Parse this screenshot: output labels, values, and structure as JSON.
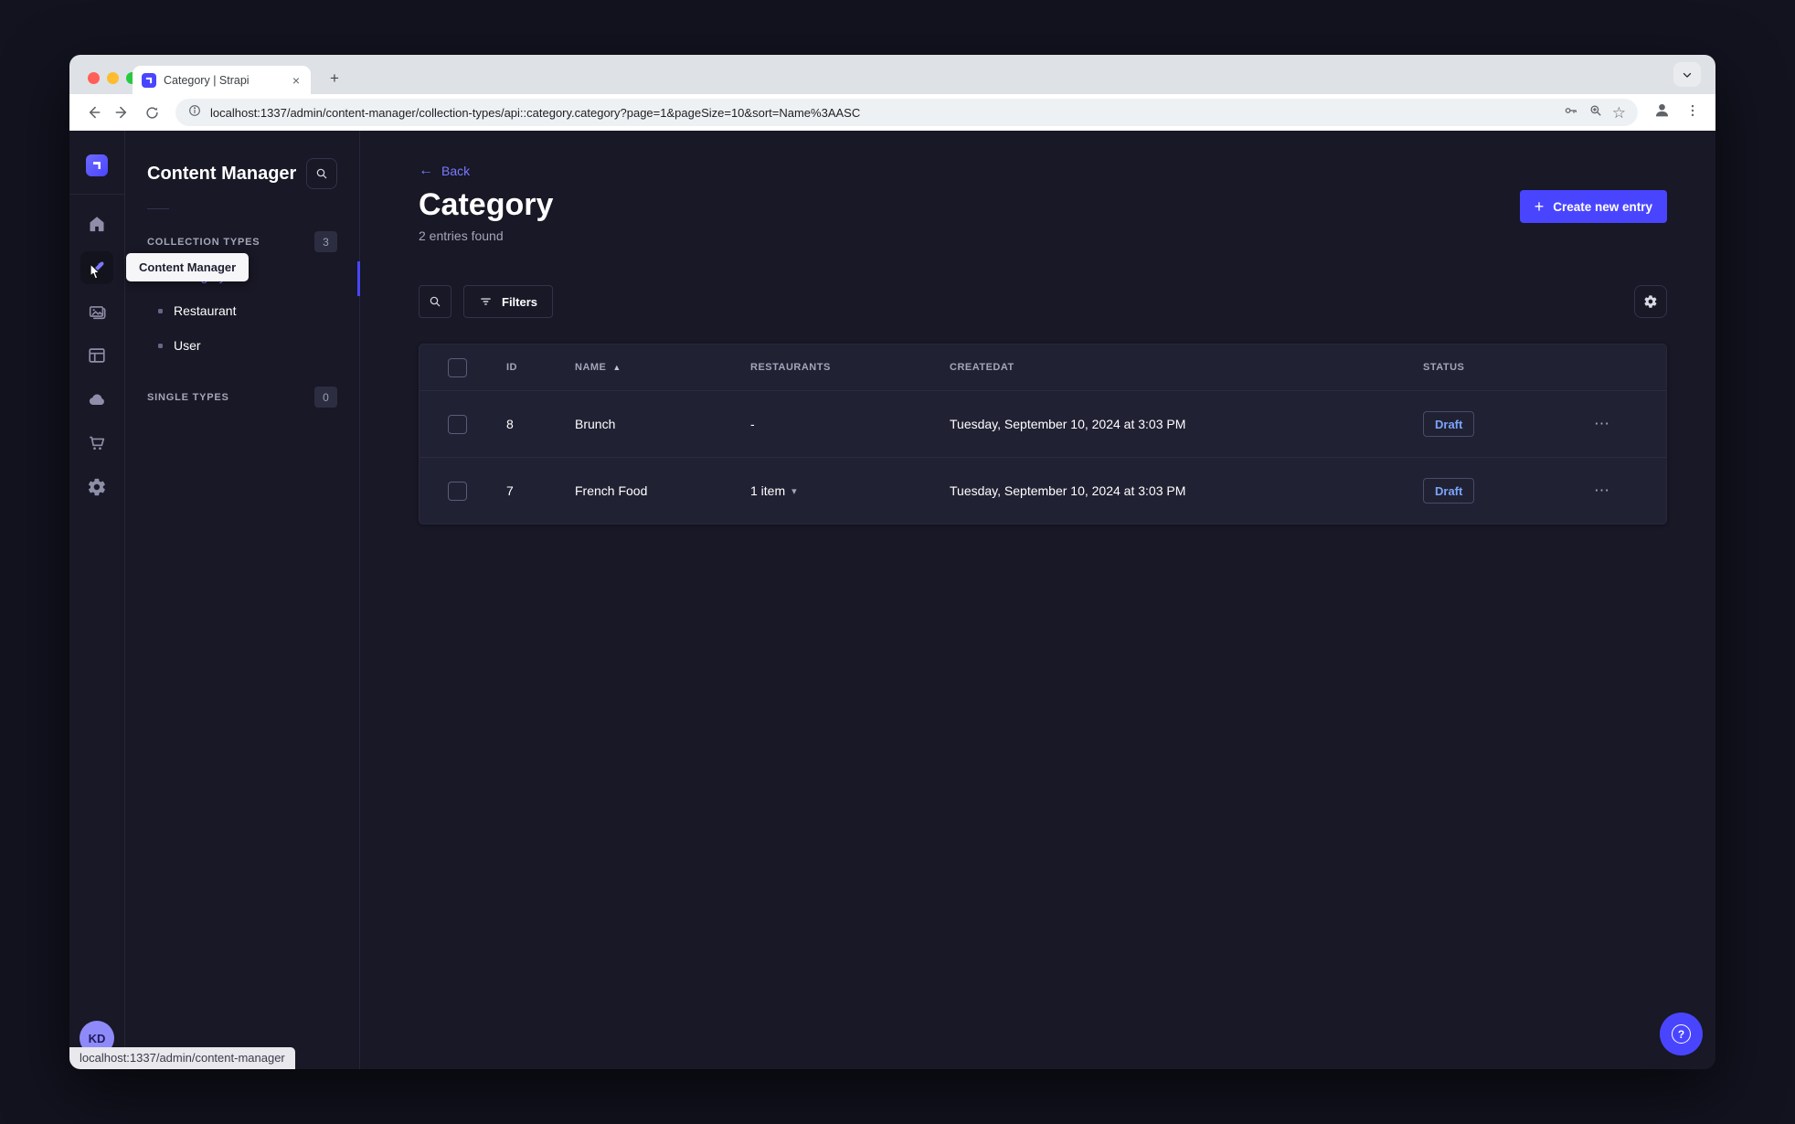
{
  "colors": {
    "primary": "#4945ff",
    "link": "#7b79ff",
    "draft_text": "#7ba4f8",
    "app_bg": "#181826",
    "card_bg": "#212134",
    "traffic_red": "#ff5f57",
    "traffic_yellow": "#febc2e",
    "traffic_green": "#28c840"
  },
  "browser": {
    "tab_title": "Category | Strapi",
    "url": "localhost:1337/admin/content-manager/collection-types/api::category.category?page=1&pageSize=10&sort=Name%3AASC",
    "status_url": "localhost:1337/admin/content-manager"
  },
  "icons": {
    "plus": "+",
    "close": "×",
    "star": "☆",
    "back_arrow": "←",
    "sort_asc": "▲",
    "item_chevron": "▾",
    "ellipsis": "⋯",
    "question": "?"
  },
  "rail": {
    "user_initials": "KD"
  },
  "sidebar": {
    "title": "Content Manager",
    "tooltip": "Content Manager",
    "collection_section": "COLLECTION TYPES",
    "collection_badge": "3",
    "items": [
      {
        "label": "Category"
      },
      {
        "label": "Restaurant"
      },
      {
        "label": "User"
      }
    ],
    "single_section": "SINGLE TYPES",
    "single_badge": "0"
  },
  "main": {
    "back": "Back",
    "title": "Category",
    "subtitle": "2 entries found",
    "create_button": "Create new entry",
    "filters_button": "Filters",
    "table": {
      "headers": {
        "id": "ID",
        "name": "NAME",
        "restaurants": "RESTAURANTS",
        "createdat": "CREATEDAT",
        "status": "STATUS"
      },
      "rows": [
        {
          "id": "8",
          "name": "Brunch",
          "restaurants": "-",
          "created": "Tuesday, September 10, 2024 at 3:03 PM",
          "status": "Draft"
        },
        {
          "id": "7",
          "name": "French Food",
          "restaurants": "1 item",
          "created": "Tuesday, September 10, 2024 at 3:03 PM",
          "status": "Draft"
        }
      ]
    }
  }
}
